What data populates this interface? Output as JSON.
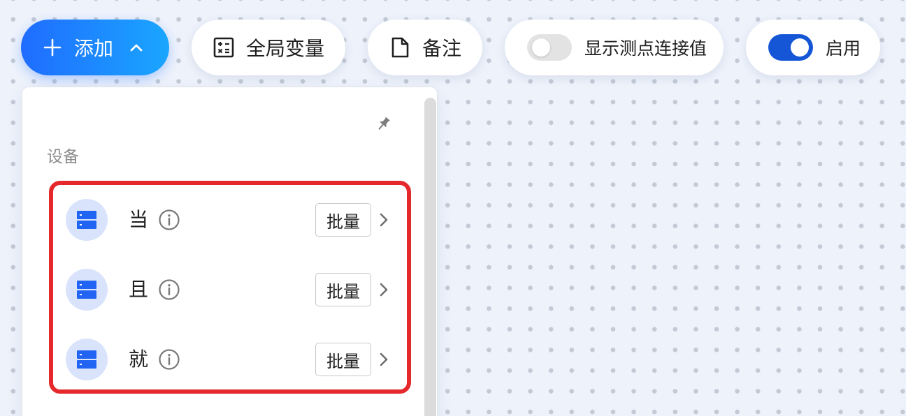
{
  "toolbar": {
    "add_label": "添加",
    "global_vars_label": "全局变量",
    "note_label": "备注",
    "show_point_values": {
      "label": "显示测点连接值",
      "on": false
    },
    "enable": {
      "label": "启用",
      "on": true
    }
  },
  "panel": {
    "section_title": "设备",
    "items": [
      {
        "label": "当",
        "batch_label": "批量"
      },
      {
        "label": "且",
        "batch_label": "批量"
      },
      {
        "label": "就",
        "batch_label": "批量"
      }
    ]
  },
  "colors": {
    "accent_gradient_start": "#1f6cff",
    "accent_gradient_end": "#1aa6ff",
    "toggle_on": "#1456d6",
    "highlight": "#e5282b",
    "device_icon": "#2163f3"
  }
}
